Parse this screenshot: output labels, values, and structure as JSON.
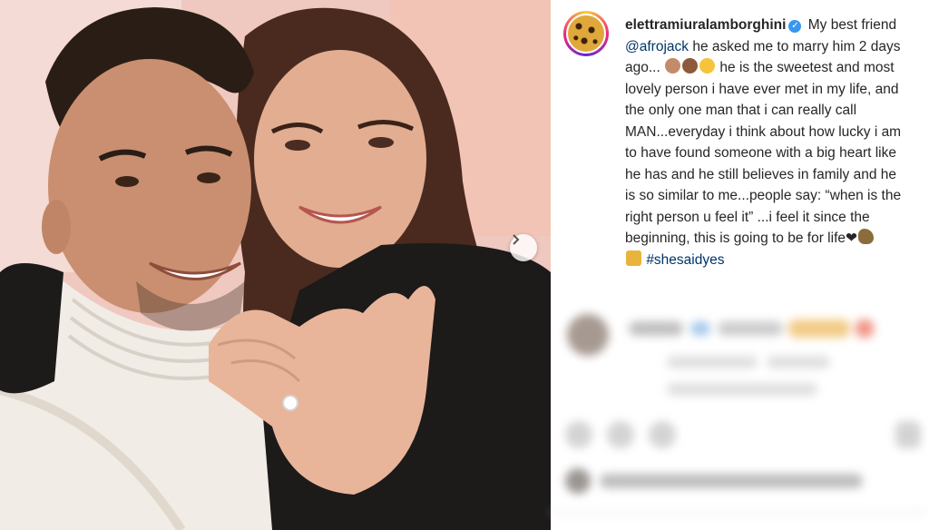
{
  "post": {
    "username": "elettramiuralamborghini",
    "verified": true,
    "caption_part1": "My best friend",
    "mention": "@afrojack",
    "caption_part2": "he asked me to marry him 2 days ago...",
    "caption_part3": "he is the sweetest and most lovely person i have ever met in my life, and the only one man that i can really call MAN...everyday i think about how lucky i am to have found someone with a big heart like he has and he still believes in family and he is so similar to me...people say: “when is the right person u feel it” ...i feel it since the beginning, this is going to be for life",
    "hashtag": "#shesaidyes"
  },
  "icons": {
    "verified": "verified-badge-icon",
    "next": "chevron-right-icon",
    "emojis": [
      "woman-emoji",
      "man-in-tuxedo-emoji",
      "crying-face-emoji",
      "heart-emoji",
      "duck-emoji",
      "lock-emoji"
    ]
  },
  "colors": {
    "text": "#262626",
    "link": "#003569",
    "verified": "#3897f0"
  }
}
